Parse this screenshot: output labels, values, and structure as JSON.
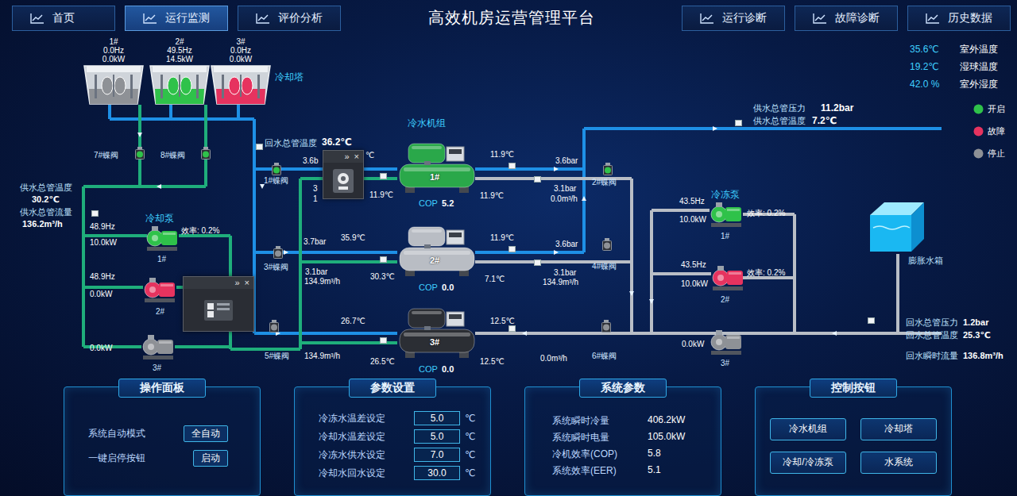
{
  "nav": {
    "left": [
      {
        "label": "首页",
        "selected": false
      },
      {
        "label": "运行监测",
        "selected": true
      },
      {
        "label": "评价分析",
        "selected": false
      }
    ],
    "title": "高效机房运营管理平台",
    "right": [
      {
        "label": "运行诊断",
        "selected": false
      },
      {
        "label": "故障诊断",
        "selected": false
      },
      {
        "label": "历史数据",
        "selected": false
      }
    ]
  },
  "weather": [
    {
      "value": "35.6℃",
      "label": "室外温度"
    },
    {
      "value": "19.2℃",
      "label": "湿球温度"
    },
    {
      "value": "42.0 %",
      "label": "室外湿度"
    }
  ],
  "legend": [
    {
      "label": "开启",
      "color": "#2fc24a"
    },
    {
      "label": "故障",
      "color": "#e6335f"
    },
    {
      "label": "停止",
      "color": "#8e9196"
    }
  ],
  "cooling_towers": {
    "title": "冷却塔",
    "items": [
      {
        "name": "1#",
        "freq": "0.0Hz",
        "power": "0.0kW",
        "state": "stop"
      },
      {
        "name": "2#",
        "freq": "49.5Hz",
        "power": "14.5kW",
        "state": "on"
      },
      {
        "name": "3#",
        "freq": "0.0Hz",
        "power": "0.0kW",
        "state": "fault"
      }
    ]
  },
  "valves": [
    {
      "label": "7#蝶阀",
      "state": "on"
    },
    {
      "label": "8#蝶阀",
      "state": "on"
    },
    {
      "label": "1#蝶阀",
      "state": "on"
    },
    {
      "label": "3#蝶阀",
      "state": "stop"
    },
    {
      "label": "5#蝶阀",
      "state": "stop"
    },
    {
      "label": "2#蝶阀",
      "state": "on"
    },
    {
      "label": "4#蝶阀",
      "state": "stop"
    },
    {
      "label": "6#蝶阀",
      "state": "stop"
    }
  ],
  "cooling_supply": {
    "temp_label": "供水总管温度",
    "temp": "30.2℃",
    "flow_label": "供水总管流量",
    "flow": "136.2m³/h"
  },
  "cooling_return": {
    "temp_label": "回水总管温度",
    "temp": "36.2℃"
  },
  "cooling_pumps": {
    "title": "冷却泵",
    "items": [
      {
        "name": "1#",
        "freq": "48.9Hz",
        "power": "10.0kW",
        "efficiency": "效率: 0.2%",
        "state": "on"
      },
      {
        "name": "2#",
        "freq": "48.9Hz",
        "power": "0.0kW",
        "state": "fault"
      },
      {
        "name": "3#",
        "power": "0.0kW",
        "state": "stop"
      }
    ]
  },
  "chillers": {
    "title": "冷水机组",
    "items": [
      {
        "name": "1#",
        "cop_label": "COP",
        "cop": "5.2",
        "color": "#2aa84a",
        "readings": [
          "3.6b",
          "3",
          "1",
          "℃",
          "11.9℃",
          "11.9℃",
          "3.6bar",
          "11.9℃",
          "3.1bar",
          "0.0m³/h"
        ]
      },
      {
        "name": "2#",
        "cop_label": "COP",
        "cop": "0.0",
        "color": "#b9bdc4",
        "readings": [
          "3.7bar",
          "35.9℃",
          "3.1bar",
          "134.9m³/h",
          "30.3℃",
          "11.9℃",
          "3.6bar",
          "7.1℃",
          "3.1bar",
          "134.9m³/h"
        ]
      },
      {
        "name": "3#",
        "cop_label": "COP",
        "cop": "0.0",
        "color": "#2b2e34",
        "readings": [
          "26.7℃",
          "134.9m³/h",
          "26.5℃",
          "12.5℃",
          "12.5℃",
          "0.0m³/h"
        ]
      }
    ]
  },
  "chilled_supply": {
    "pressure_label": "供水总管压力",
    "pressure": "11.2bar",
    "temp_label": "供水总管温度",
    "temp": "7.2℃"
  },
  "chilled_pumps": {
    "title": "冷冻泵",
    "items": [
      {
        "name": "1#",
        "freq": "43.5Hz",
        "power": "10.0kW",
        "efficiency": "效率: 0.2%",
        "state": "on"
      },
      {
        "name": "2#",
        "freq": "43.5Hz",
        "power": "10.0kW",
        "efficiency": "效率: 0.2%",
        "state": "fault"
      },
      {
        "name": "3#",
        "power": "0.0kW",
        "state": "stop"
      }
    ]
  },
  "expansion_tank": {
    "label": "膨胀水箱"
  },
  "chilled_return": {
    "pressure_label": "回水总管压力",
    "pressure": "1.2bar",
    "temp_label": "回水总管温度",
    "temp": "25.3℃",
    "flow_label": "回水瞬时流量",
    "flow": "136.8m³/h"
  },
  "popups": [
    {
      "expand": "»",
      "close": "×"
    },
    {
      "expand": "»",
      "close": "×"
    }
  ],
  "panels": {
    "operation": {
      "title": "操作面板",
      "rows": [
        {
          "label": "系统自动模式",
          "button": "全自动"
        },
        {
          "label": "一键启停按钮",
          "button": "启动"
        }
      ]
    },
    "settings": {
      "title": "参数设置",
      "rows": [
        {
          "label": "冷冻水温差设定",
          "value": "5.0",
          "unit": "℃"
        },
        {
          "label": "冷却水温差设定",
          "value": "5.0",
          "unit": "℃"
        },
        {
          "label": "冷冻水供水设定",
          "value": "7.0",
          "unit": "℃"
        },
        {
          "label": "冷却水回水设定",
          "value": "30.0",
          "unit": "℃"
        }
      ]
    },
    "system": {
      "title": "系统参数",
      "rows": [
        {
          "label": "系统瞬时冷量",
          "value": "406.2kW"
        },
        {
          "label": "系统瞬时电量",
          "value": "105.0kW"
        },
        {
          "label": "冷机效率(COP)",
          "value": "5.8"
        },
        {
          "label": "系统效率(EER)",
          "value": "5.1"
        }
      ]
    },
    "controls": {
      "title": "控制按钮",
      "buttons": [
        "冷水机组",
        "冷却塔",
        "冷却/冷冻泵",
        "水系统"
      ]
    }
  }
}
